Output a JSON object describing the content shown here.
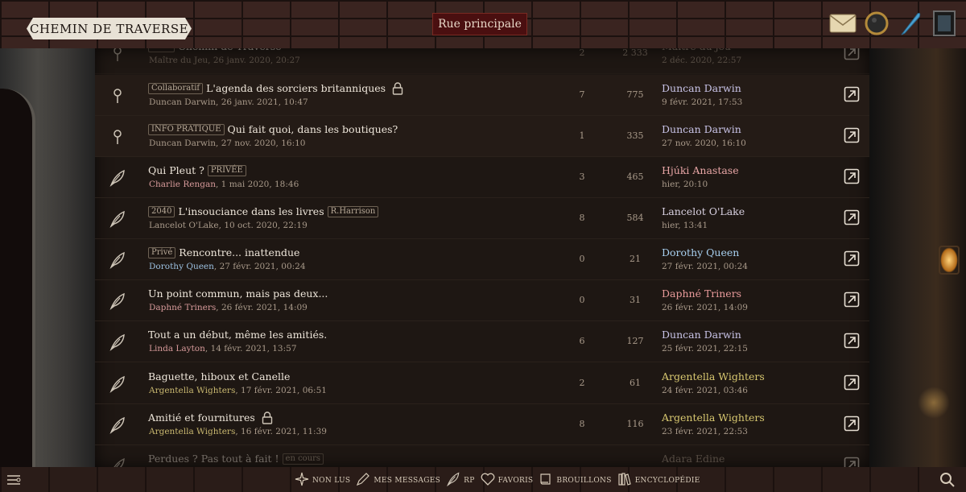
{
  "header": {
    "site_title": "CHEMIN DE TRAVERSE",
    "main_button": "Rue principale",
    "icons": [
      "envelope-icon",
      "mirror-icon",
      "quill-icon",
      "portrait-icon"
    ]
  },
  "topics": [
    {
      "icon": "pin-icon",
      "tag": "Infos",
      "title": "Chemin de Traverse",
      "locked": false,
      "author": "Maître du Jeu",
      "author_color": "#a99a8a",
      "date": "26 janv. 2020, 20:27",
      "replies": "2",
      "views": "2 333",
      "last_user": "Maître du jeu",
      "last_color": "#a99a8a",
      "last_date": "2 déc. 2020, 22:57"
    },
    {
      "icon": "pin-icon",
      "tag": "Collaboratif",
      "title": "L'agenda des sorciers britanniques",
      "locked": true,
      "author": "Duncan Darwin",
      "author_color": "#a99a8a",
      "date": "26 janv. 2021, 10:47",
      "replies": "7",
      "views": "775",
      "last_user": "Duncan Darwin",
      "last_color": "#c9c4e8",
      "last_date": "9 févr. 2021, 17:53"
    },
    {
      "icon": "pin-icon",
      "tag": "INFO PRATIQUE",
      "title": "Qui fait quoi, dans les boutiques?",
      "locked": false,
      "author": "Duncan Darwin",
      "author_color": "#a99a8a",
      "date": "27 nov. 2020, 16:10",
      "replies": "1",
      "views": "335",
      "last_user": "Duncan Darwin",
      "last_color": "#c9c4e8",
      "last_date": "27 nov. 2020, 16:10"
    },
    {
      "icon": "feather-icon",
      "tag": "",
      "title": "Qui Pleut ?",
      "tag_after": "PRIVÉE",
      "locked": false,
      "author": "Charlie Rengan",
      "author_color": "#d79a9a",
      "date": "1 mai 2020, 18:46",
      "replies": "3",
      "views": "465",
      "last_user": "Hjúki Anastase",
      "last_color": "#e8a6a6",
      "last_date": "hier, 20:10"
    },
    {
      "icon": "feather-icon",
      "tag": "2040",
      "title": "L'insouciance dans les livres",
      "tag_after": "R.Harrison",
      "locked": false,
      "author": "Lancelot O'Lake",
      "author_color": "#a99a8a",
      "date": "10 oct. 2020, 22:19",
      "replies": "8",
      "views": "584",
      "last_user": "Lancelot O'Lake",
      "last_color": "#d8d0e0",
      "last_date": "hier, 13:41"
    },
    {
      "icon": "feather-icon",
      "tag": "Privé",
      "title": "Rencontre... inattendue",
      "locked": false,
      "author": "Dorothy Queen",
      "author_color": "#9cc0e0",
      "date": "27 févr. 2021, 00:24",
      "replies": "0",
      "views": "21",
      "last_user": "Dorothy Queen",
      "last_color": "#a8d0f0",
      "last_date": "27 févr. 2021, 00:24"
    },
    {
      "icon": "feather-icon",
      "tag": "",
      "title": "Un point commun, mais pas deux...",
      "locked": false,
      "author": "Daphné Triners",
      "author_color": "#d79a9a",
      "date": "26 févr. 2021, 14:09",
      "replies": "0",
      "views": "31",
      "last_user": "Daphné Triners",
      "last_color": "#e89a9a",
      "last_date": "26 févr. 2021, 14:09"
    },
    {
      "icon": "feather-icon",
      "tag": "",
      "title": "Tout a un début, même les amitiés.",
      "locked": false,
      "author": "Linda Layton",
      "author_color": "#d79a9a",
      "date": "14 févr. 2021, 13:57",
      "replies": "6",
      "views": "127",
      "last_user": "Duncan Darwin",
      "last_color": "#c9c4e8",
      "last_date": "25 févr. 2021, 22:15"
    },
    {
      "icon": "feather-icon",
      "tag": "",
      "title": "Baguette, hiboux et Canelle",
      "locked": false,
      "author": "Argentella Wighters",
      "author_color": "#c9b870",
      "date": "17 févr. 2021, 06:51",
      "replies": "2",
      "views": "61",
      "last_user": "Argentella Wighters",
      "last_color": "#d8c870",
      "last_date": "24 févr. 2021, 03:46"
    },
    {
      "icon": "feather-icon",
      "tag": "",
      "title": "Amitié et fournitures",
      "locked": true,
      "author": "Argentella Wighters",
      "author_color": "#c9b870",
      "date": "16 févr. 2021, 11:39",
      "replies": "8",
      "views": "116",
      "last_user": "Argentella Wighters",
      "last_color": "#d8c870",
      "last_date": "23 févr. 2021, 22:53"
    },
    {
      "icon": "feather-icon",
      "tag": "",
      "title": "Perdues ? Pas tout à fait !",
      "tag_after": "en cours",
      "locked": false,
      "author": "",
      "author_color": "#a99a8a",
      "date": "",
      "replies": "",
      "views": "",
      "last_user": "Adara Edine",
      "last_color": "#a99a8a",
      "last_date": ""
    }
  ],
  "bottom_nav": [
    {
      "icon": "sparkle-icon",
      "label": "NON LUS"
    },
    {
      "icon": "pen-icon",
      "label": "MES MESSAGES"
    },
    {
      "icon": "feather-icon",
      "label": "RP"
    },
    {
      "icon": "heart-icon",
      "label": "FAVORIS"
    },
    {
      "icon": "scroll-icon",
      "label": "BROUILLONS"
    },
    {
      "icon": "books-icon",
      "label": "ENCYCLOPÉDIE"
    }
  ]
}
